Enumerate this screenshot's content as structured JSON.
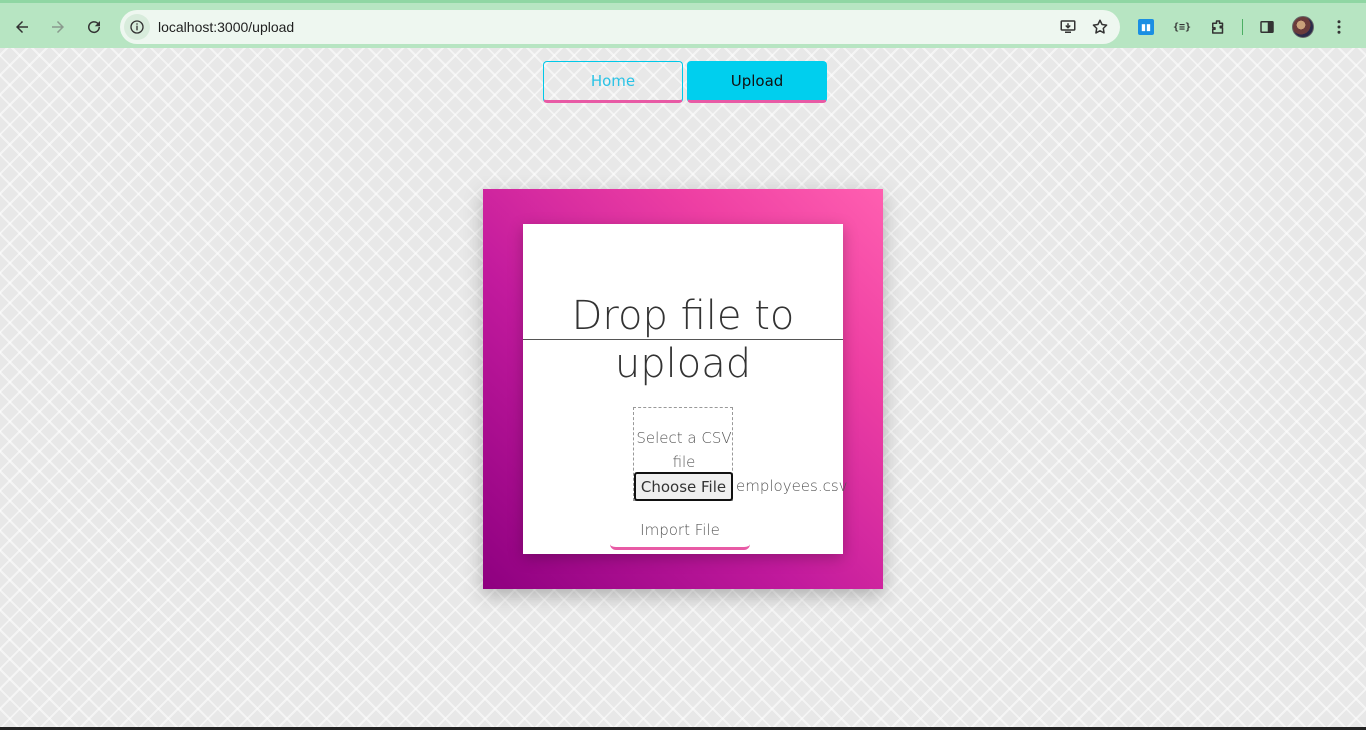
{
  "browser": {
    "url": "localhost:3000/upload",
    "icons": [
      "back-icon",
      "forward-icon",
      "reload-icon",
      "site-info-icon",
      "install-app-icon",
      "bookmark-star-icon",
      "trello-extension-icon",
      "json-extension-icon",
      "extensions-puzzle-icon",
      "side-panel-icon",
      "profile-avatar",
      "menu-kebab-icon"
    ]
  },
  "nav": {
    "home_label": "Home",
    "upload_label": "Upload"
  },
  "upload": {
    "title": "Drop file to upload",
    "dropzone_label": "Select a CSV file",
    "choose_file_label": "Choose File",
    "selected_file": "employees.csv",
    "import_label": "Import File"
  },
  "colors": {
    "accent_cyan": "#00cfee",
    "accent_pink": "#e85aa5",
    "card_gradient_start": "#8e0080",
    "card_gradient_end": "#ff5fb0",
    "browser_chrome": "#b7e5c2"
  }
}
